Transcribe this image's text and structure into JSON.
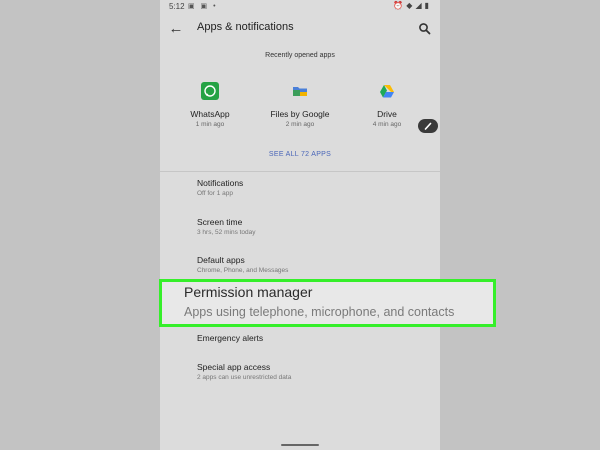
{
  "status_bar": {
    "time": "5:12"
  },
  "app_bar": {
    "title": "Apps & notifications"
  },
  "recent": {
    "section_title": "Recently opened apps",
    "apps": [
      {
        "name": "WhatsApp",
        "time": "1 min ago",
        "icon": "whatsapp-icon",
        "color": "#25a244"
      },
      {
        "name": "Files by Google",
        "time": "2 min ago",
        "icon": "files-icon",
        "color": "#4a7fd8"
      },
      {
        "name": "Drive",
        "time": "4 min ago",
        "icon": "drive-icon",
        "color": "#fbbc05"
      }
    ],
    "see_all": "SEE ALL 72 APPS"
  },
  "list": [
    {
      "title": "Notifications",
      "subtitle": "Off for 1 app"
    },
    {
      "title": "Screen time",
      "subtitle": "3 hrs, 52 mins today"
    },
    {
      "title": "Default apps",
      "subtitle": "Chrome, Phone, and Messages"
    },
    {
      "title": "Emergency alerts",
      "subtitle": ""
    },
    {
      "title": "Special app access",
      "subtitle": "2 apps can use unrestricted data"
    }
  ],
  "highlight": {
    "title": "Permission manager",
    "subtitle": "Apps using telephone, microphone, and contacts",
    "border_color": "#35ef2a"
  }
}
